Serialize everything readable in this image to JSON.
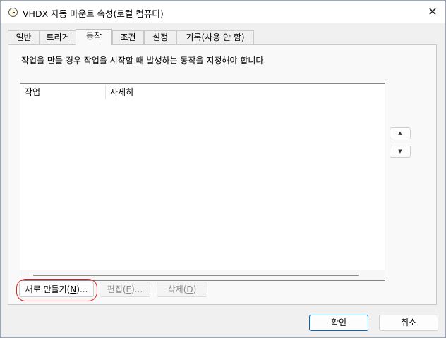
{
  "window": {
    "title": "VHDX 자동 마운트 속성(로컬 컴퓨터)",
    "icon": "clock-icon",
    "close_glyph": "✕"
  },
  "tabs": [
    {
      "label": "일반",
      "active": false
    },
    {
      "label": "트리거",
      "active": false
    },
    {
      "label": "동작",
      "active": true
    },
    {
      "label": "조건",
      "active": false
    },
    {
      "label": "설정",
      "active": false
    },
    {
      "label": "기록(사용 안 함)",
      "active": false
    }
  ],
  "actions_page": {
    "instructions": "작업을 만들 경우 작업을 시작할 때 발생하는 동작을 지정해야 합니다.",
    "columns": [
      "작업",
      "자세히"
    ],
    "rows": [],
    "move_up_glyph": "▲",
    "move_down_glyph": "▼"
  },
  "buttons": {
    "new_pre": "새로 만들기(",
    "new_key": "N",
    "new_post": ")...",
    "edit_pre": "편집(",
    "edit_key": "E",
    "edit_post": ")...",
    "delete_pre": "삭제(",
    "delete_key": "D",
    "delete_post": ")",
    "ok": "확인",
    "cancel": "취소"
  },
  "colors": {
    "highlight": "#e02020",
    "primary_border": "#0067c0"
  }
}
